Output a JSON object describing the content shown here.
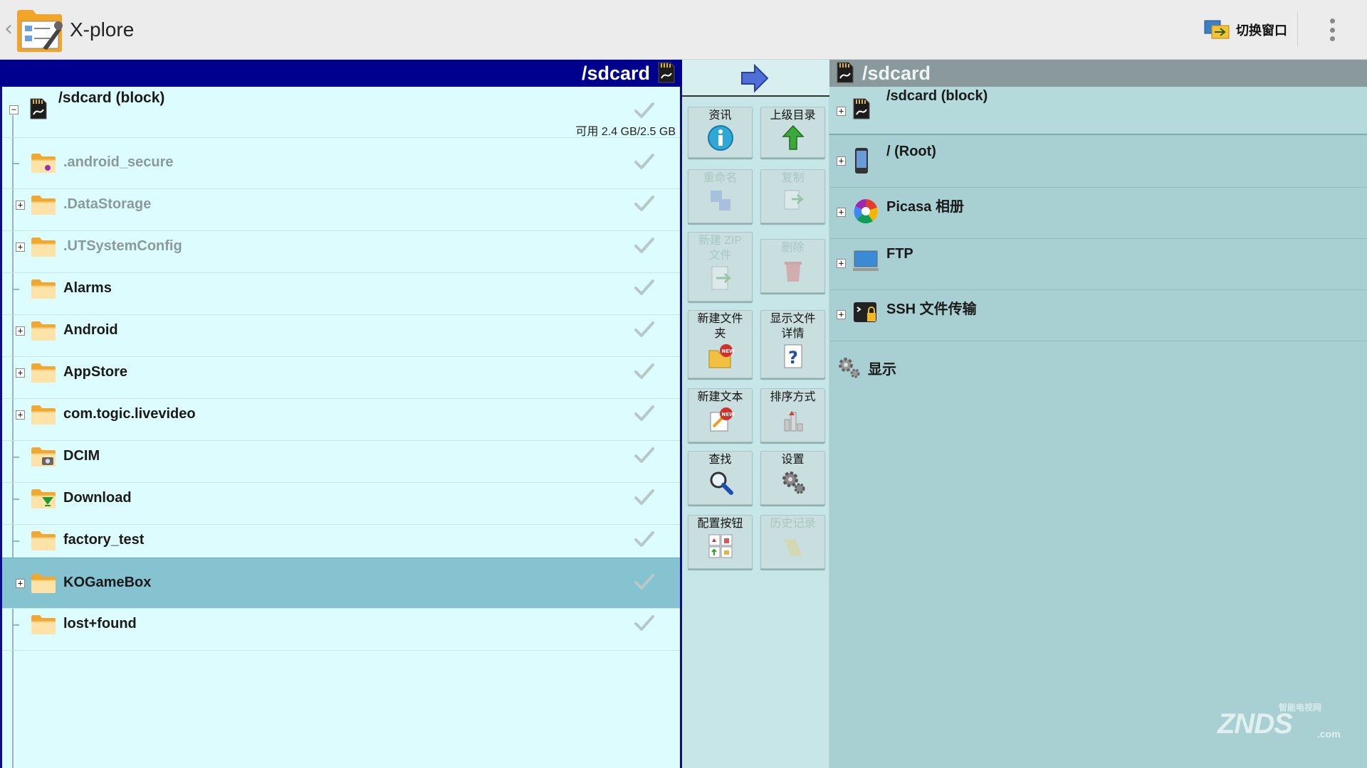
{
  "app": {
    "back": "‹",
    "title": "X-plore",
    "switch_window": "切换窗口"
  },
  "left": {
    "header_title": "/sdcard",
    "root": {
      "name": "/sdcard (block)",
      "free": "可用 2.4 GB/2.5 GB"
    },
    "items": [
      {
        "name": ".android_secure",
        "hidden": true,
        "expandable": false,
        "icon": "folder-secure-icon"
      },
      {
        "name": ".DataStorage",
        "hidden": true,
        "expandable": true,
        "icon": "folder-icon"
      },
      {
        "name": ".UTSystemConfig",
        "hidden": true,
        "expandable": true,
        "icon": "folder-icon"
      },
      {
        "name": "Alarms",
        "hidden": false,
        "expandable": false,
        "icon": "folder-icon"
      },
      {
        "name": "Android",
        "hidden": false,
        "expandable": true,
        "icon": "folder-icon"
      },
      {
        "name": "AppStore",
        "hidden": false,
        "expandable": true,
        "icon": "folder-icon"
      },
      {
        "name": "com.togic.livevideo",
        "hidden": false,
        "expandable": true,
        "icon": "folder-icon"
      },
      {
        "name": "DCIM",
        "hidden": false,
        "expandable": false,
        "icon": "camera-folder-icon"
      },
      {
        "name": "Download",
        "hidden": false,
        "expandable": false,
        "icon": "download-folder-icon"
      },
      {
        "name": "factory_test",
        "hidden": false,
        "expandable": false,
        "icon": "folder-icon"
      },
      {
        "name": "KOGameBox",
        "hidden": false,
        "expandable": true,
        "icon": "folder-icon",
        "selected": true
      },
      {
        "name": "lost+found",
        "hidden": false,
        "expandable": false,
        "icon": "folder-icon"
      }
    ]
  },
  "toolbar": {
    "info": "资讯",
    "parent_dir": "上级目录",
    "rename": "重命名",
    "copy": "复制",
    "new_zip_line1": "新建 ZIP",
    "new_zip_line2": "文件",
    "delete": "删除",
    "new_folder_line1": "新建文件",
    "new_folder_line2": "夹",
    "show_details_line1": "显示文件",
    "show_details_line2": "详情",
    "new_text": "新建文本",
    "sort": "排序方式",
    "find": "查找",
    "settings": "设置",
    "config_buttons": "配置按钮",
    "history": "历史记录"
  },
  "right": {
    "header_title": "/sdcard",
    "items": [
      {
        "name": "/sdcard (block)",
        "icon": "sd-card-icon"
      },
      {
        "name": "/ (Root)",
        "icon": "phone-icon"
      },
      {
        "name": "Picasa 相册",
        "icon": "picasa-icon"
      },
      {
        "name": "FTP",
        "icon": "ftp-computer-icon"
      },
      {
        "name": "SSH 文件传输",
        "icon": "ssh-terminal-icon"
      }
    ],
    "display": "显示"
  },
  "watermark": {
    "small": "智能电视网",
    "big": "ZNDS",
    "suffix": ".com"
  }
}
